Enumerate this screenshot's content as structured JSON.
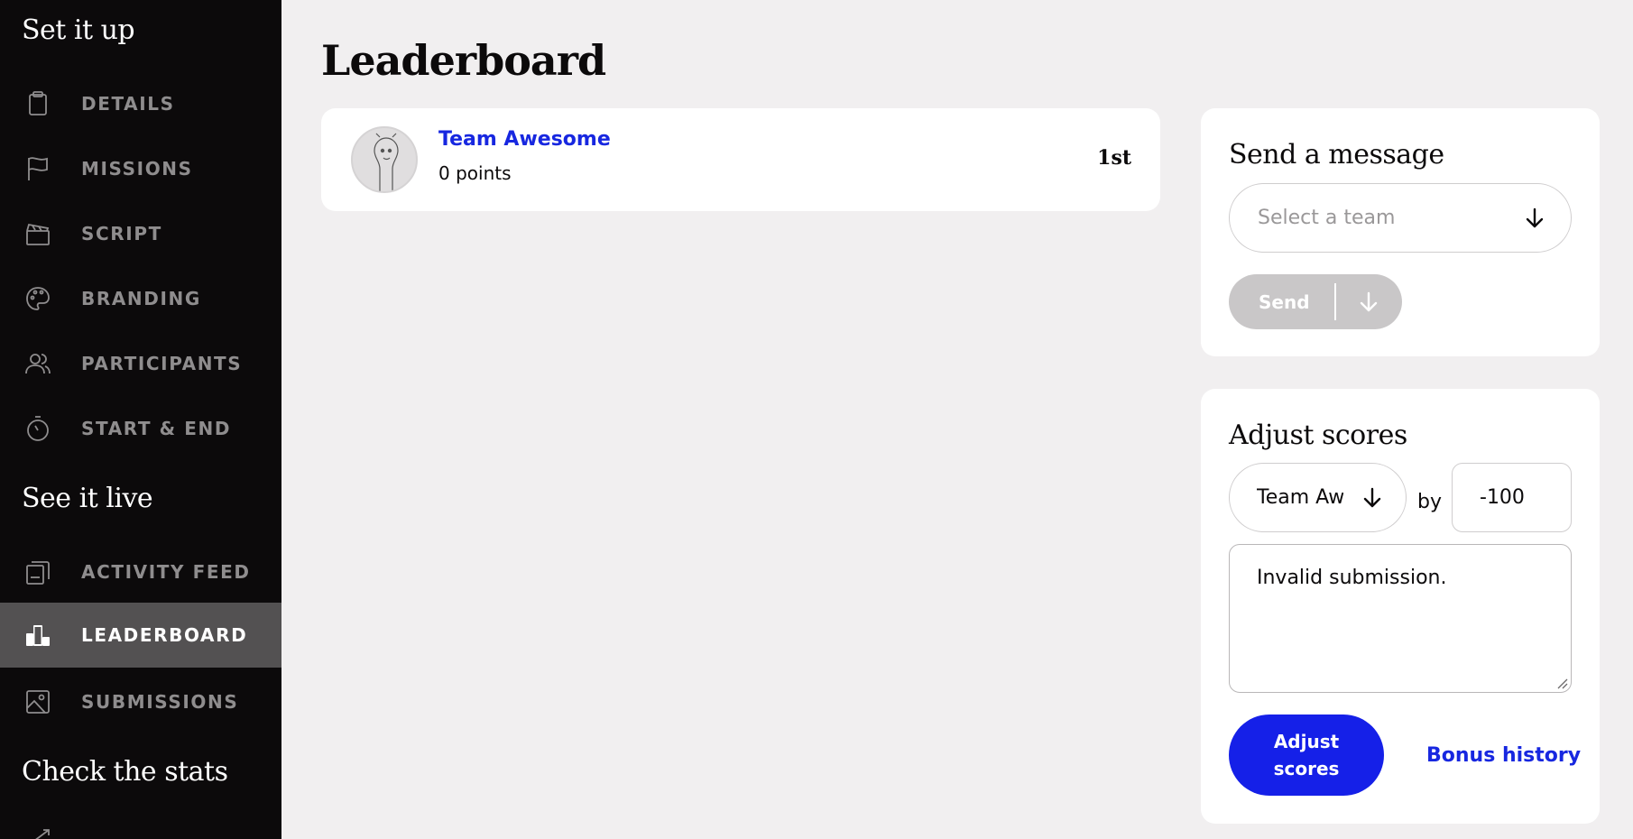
{
  "sidebar": {
    "sections": [
      {
        "title": "Set it up"
      },
      {
        "title": "See it live"
      },
      {
        "title": "Check the stats"
      }
    ],
    "items": [
      {
        "label": "DETAILS",
        "icon": "clipboard-icon"
      },
      {
        "label": "MISSIONS",
        "icon": "flag-icon"
      },
      {
        "label": "SCRIPT",
        "icon": "clapperboard-icon"
      },
      {
        "label": "BRANDING",
        "icon": "palette-icon"
      },
      {
        "label": "PARTICIPANTS",
        "icon": "users-icon"
      },
      {
        "label": "START & END",
        "icon": "stopwatch-icon"
      },
      {
        "label": "ACTIVITY FEED",
        "icon": "feed-icon"
      },
      {
        "label": "LEADERBOARD",
        "icon": "podium-icon",
        "active": true
      },
      {
        "label": "SUBMISSIONS",
        "icon": "image-icon"
      }
    ]
  },
  "main": {
    "title": "Leaderboard",
    "teams": [
      {
        "name": "Team Awesome",
        "points": "0 points",
        "rank": "1st"
      }
    ]
  },
  "message_panel": {
    "title": "Send a message",
    "team_placeholder": "Select a team",
    "send_label": "Send"
  },
  "adjust_panel": {
    "title": "Adjust scores",
    "team_value": "Team Awesome",
    "by_label": "by",
    "amount_value": "-100",
    "reason_value": "Invalid submission.",
    "adjust_button_label": "Adjust scores",
    "bonus_history_label": "Bonus history"
  },
  "colors": {
    "sidebar_bg": "#0c0a0b",
    "active_item_bg": "#535152",
    "accent_blue": "#1727e0",
    "page_bg": "#f1eff0"
  }
}
